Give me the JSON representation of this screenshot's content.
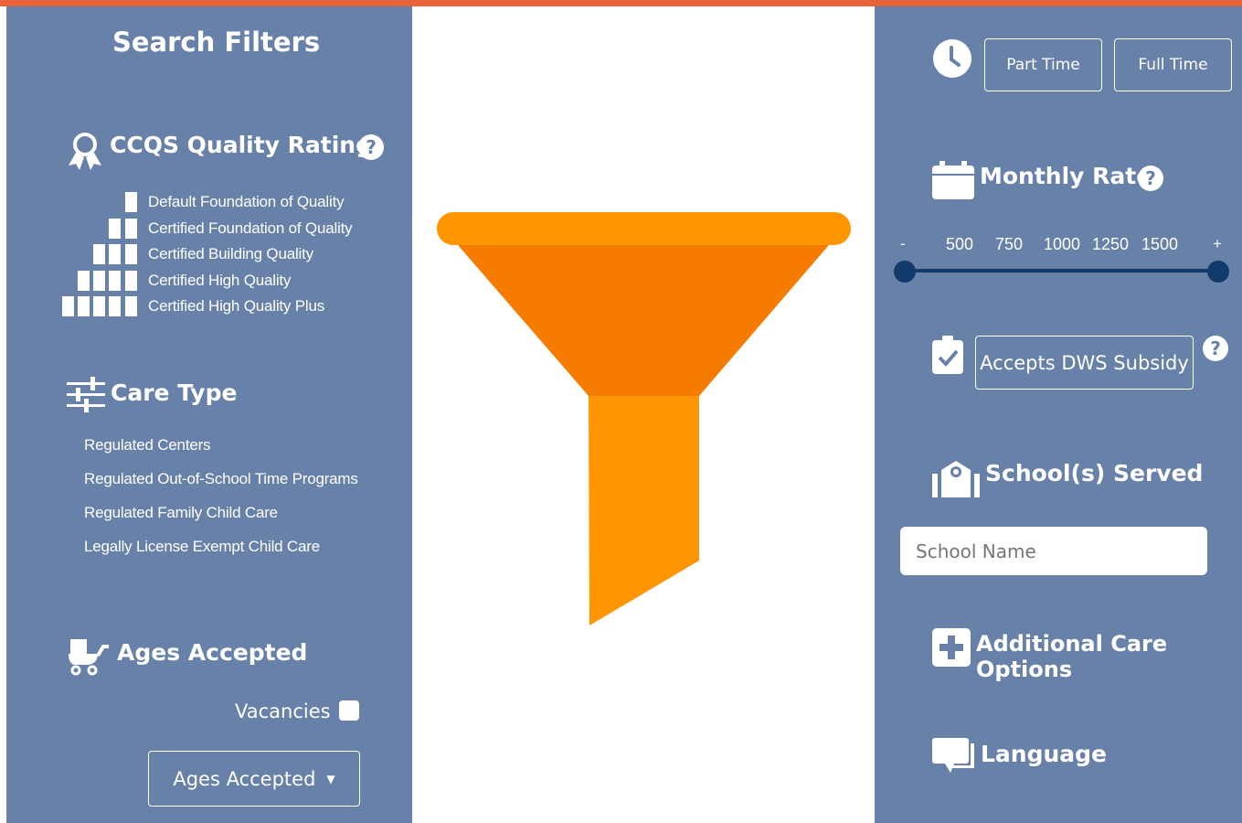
{
  "left_panel": {
    "title": "Search Filters",
    "quality": {
      "title": "CCQS Quality Rating",
      "help": "?",
      "levels": [
        "Default Foundation of Quality",
        "Certified Foundation of Quality",
        "Certified Building Quality",
        "Certified High Quality",
        "Certified High Quality Plus"
      ]
    },
    "care_type": {
      "title": "Care Type",
      "items": [
        "Regulated Centers",
        "Regulated Out-of-School Time Programs",
        "Regulated Family Child Care",
        "Legally License Exempt Child Care"
      ]
    },
    "ages": {
      "title": "Ages Accepted",
      "vacancies_label": "Vacancies",
      "dropdown_label": "Ages Accepted"
    }
  },
  "right_panel": {
    "schedule": {
      "part_time": "Part Time",
      "full_time": "Full Time"
    },
    "monthly_rate": {
      "title": "Monthly Rate",
      "help": "?",
      "minus": "-",
      "plus": "+",
      "ticks": [
        "500",
        "750",
        "1000",
        "1250",
        "1500"
      ]
    },
    "subsidy": {
      "label": "Accepts DWS Subsidy",
      "help": "?"
    },
    "schools": {
      "title": "School(s) Served",
      "placeholder": "School Name"
    },
    "additional": {
      "title": "Additional Care Options"
    },
    "language": {
      "title": "Language"
    }
  },
  "colors": {
    "panel": "#6781a8",
    "accent_top": "#e8623a",
    "funnel": "#f57c00",
    "slider": "#123a6b"
  },
  "icons": [
    "award-icon",
    "sliders-icon",
    "stroller-icon",
    "clock-icon",
    "calendar-icon",
    "clipboard-check-icon",
    "school-icon",
    "plus-square-icon",
    "chat-icon",
    "question-icon",
    "caret-down-icon",
    "funnel-icon"
  ]
}
